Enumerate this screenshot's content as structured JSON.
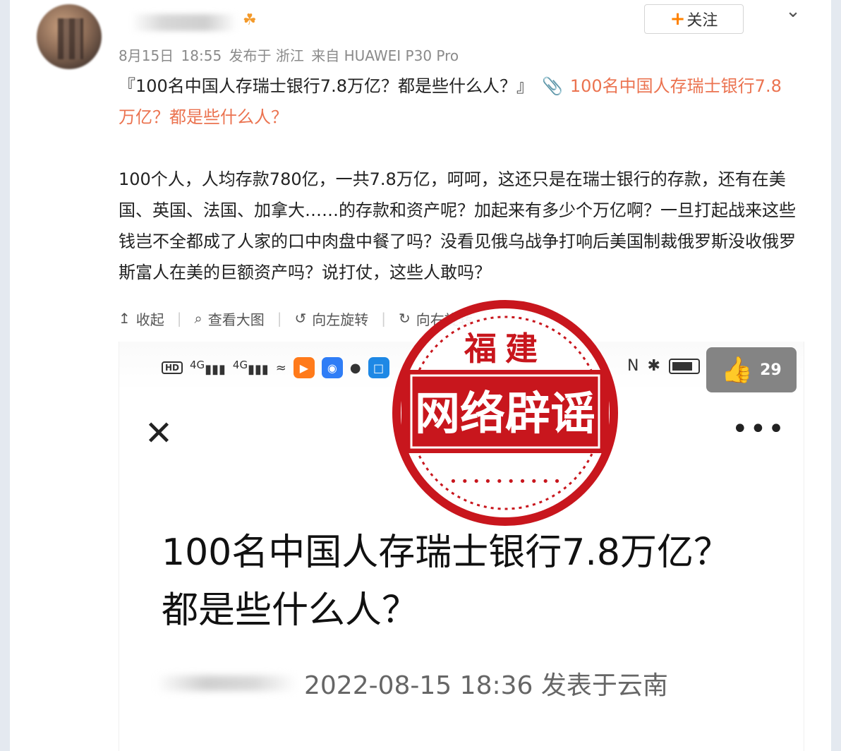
{
  "header": {
    "follow_label": "关注",
    "follow_plus": "+",
    "meta": {
      "date": "8月15日",
      "time": "18:55",
      "location": "发布于 浙江",
      "device": "来自 HUAWEI P30 Pro"
    }
  },
  "post": {
    "title": "『100名中国人存瑞士银行7.8万亿？都是些什么人？』",
    "link_text": "100名中国人存瑞士银行7.8万亿？都是些什么人？",
    "body": "100个人，人均存款780亿，一共7.8万亿，呵呵，这还只是在瑞士银行的存款，还有在美国、英国、法国、加拿大……的存款和资产呢？加起来有多少个万亿啊？一旦打起战来这些钱岂不全都成了人家的口中肉盘中餐了吗？没看见俄乌战争打响后美国制裁俄罗斯没收俄罗斯富人在美的巨额资产吗？说打仗，这些人敢吗？"
  },
  "actions": [
    {
      "icon": "collapse-icon",
      "glyph": "↥",
      "label": "收起"
    },
    {
      "icon": "magnifier-icon",
      "glyph": "⌕",
      "label": "查看大图"
    },
    {
      "icon": "rotate-left-icon",
      "glyph": "↺",
      "label": "向左旋转"
    },
    {
      "icon": "rotate-right-icon",
      "glyph": "↻",
      "label": "向右旋转"
    }
  ],
  "embedded": {
    "signal": "4G",
    "like_count": "29",
    "title": "100名中国人存瑞士银行7.8万亿？都是些什么人？",
    "meta": "2022-08-15 18:36  发表于云南"
  },
  "stamp": {
    "top_text": "福建",
    "main_text": "网络辟谣",
    "color": "#c8161d"
  }
}
